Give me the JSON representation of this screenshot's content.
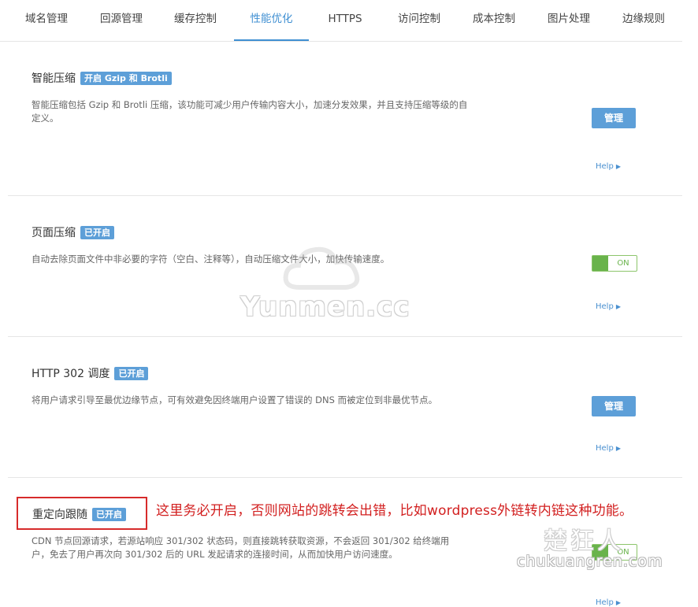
{
  "tabs": [
    {
      "label": "域名管理"
    },
    {
      "label": "回源管理"
    },
    {
      "label": "缓存控制"
    },
    {
      "label": "性能优化",
      "active": true
    },
    {
      "label": "HTTPS"
    },
    {
      "label": "访问控制"
    },
    {
      "label": "成本控制"
    },
    {
      "label": "图片处理"
    },
    {
      "label": "边缘规则"
    }
  ],
  "sections": [
    {
      "title": "智能压缩",
      "badge": "开启 Gzip 和 Brotli",
      "description": "智能压缩包括 Gzip 和 Brotli 压缩，该功能可减少用户传输内容大小，加速分发效果，并且支持压缩等级的自定义。",
      "control": "button",
      "button_label": "管理",
      "help_label": "Help"
    },
    {
      "title": "页面压缩",
      "badge": "已开启",
      "description": "自动去除页面文件中非必要的字符（空白、注释等），自动压缩文件大小，加快传输速度。",
      "control": "toggle",
      "toggle_label": "ON",
      "help_label": "Help"
    },
    {
      "title": "HTTP 302 调度",
      "badge": "已开启",
      "description": "将用户请求引导至最优边缘节点，可有效避免因终端用户设置了错误的 DNS 而被定位到非最优节点。",
      "control": "button",
      "button_label": "管理",
      "help_label": "Help"
    },
    {
      "title": "重定向跟随",
      "badge": "已开启",
      "description": "CDN 节点回源请求，若源站响应 301/302 状态码，则直接跳转获取资源，不会返回 301/302 给终端用户，免去了用户再次向 301/302 后的 URL 发起请求的连接时间，从而加快用户访问速度。",
      "control": "toggle",
      "toggle_label": "ON",
      "help_label": "Help"
    }
  ],
  "annotation": {
    "text": "这里务必开启，否则网站的跳转会出错，比如wordpress外链转内链这种功能。",
    "color": "#d21f1f"
  },
  "watermarks": {
    "center": "Yunmen.cc",
    "corner_cn": "楚狂人",
    "corner_en": "chukuangren.com"
  },
  "colors": {
    "accent": "#3f8fd2",
    "badge": "#5d9fd8",
    "toggle_on": "#69b34b"
  }
}
